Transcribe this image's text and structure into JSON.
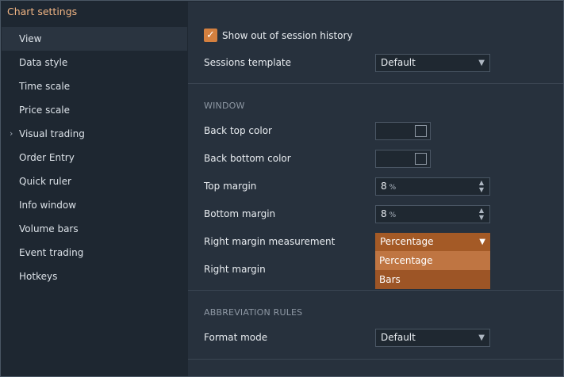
{
  "window": {
    "title": "Chart settings",
    "close_icon": "close-icon"
  },
  "sidebar": {
    "items": [
      {
        "label": "View",
        "active": true
      },
      {
        "label": "Data style"
      },
      {
        "label": "Time scale"
      },
      {
        "label": "Price scale"
      },
      {
        "label": "Visual trading",
        "expandable": true
      },
      {
        "label": "Order Entry"
      },
      {
        "label": "Quick ruler"
      },
      {
        "label": "Info window"
      },
      {
        "label": "Volume bars"
      },
      {
        "label": "Event trading"
      },
      {
        "label": "Hotkeys"
      }
    ]
  },
  "view": {
    "show_out_of_session_history": {
      "label": "Show out of session history",
      "checked": true
    },
    "sessions_template": {
      "label": "Sessions template",
      "value": "Default"
    },
    "window_section": "WINDOW",
    "back_top_color": {
      "label": "Back top color"
    },
    "back_bottom_color": {
      "label": "Back bottom color"
    },
    "top_margin": {
      "label": "Top margin",
      "value": "8",
      "unit": "%"
    },
    "bottom_margin": {
      "label": "Bottom margin",
      "value": "8",
      "unit": "%"
    },
    "right_margin_measurement": {
      "label": "Right margin measurement",
      "value": "Percentage",
      "options": [
        "Percentage",
        "Bars"
      ]
    },
    "right_margin": {
      "label": "Right margin"
    },
    "abbreviation_section": "ABBREVIATION RULES",
    "format_mode": {
      "label": "Format mode",
      "value": "Default"
    }
  },
  "colors": {
    "accent": "#d4803f",
    "dropdown": "#a45a26",
    "title": "#f0b483"
  }
}
